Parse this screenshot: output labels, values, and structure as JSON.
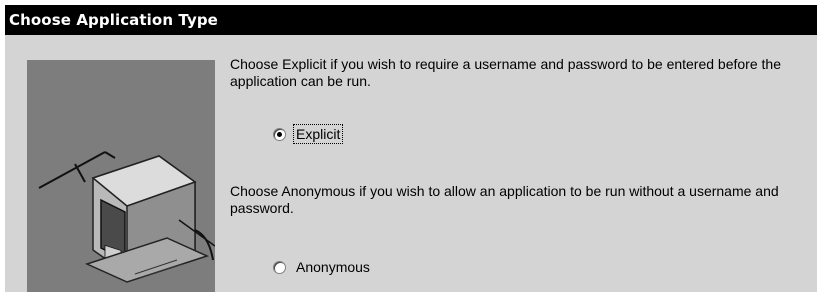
{
  "dialog": {
    "title": "Choose Application Type"
  },
  "content": {
    "explicit_description": "Choose Explicit if you wish to require a username and password to be entered before the application can be run.",
    "anonymous_description": "Choose Anonymous if you wish to allow an application to be run without a username and password."
  },
  "options": {
    "explicit": {
      "label": "Explicit",
      "selected": true
    },
    "anonymous": {
      "label": "Anonymous",
      "selected": false
    }
  },
  "icons": {
    "illustration": "computer-illustration",
    "explicit_radio": "radio-selected",
    "anonymous_radio": "radio-unselected"
  },
  "colors": {
    "title_bar_bg": "#000000",
    "title_bar_text": "#ffffff",
    "dialog_bg": "#d4d4d4",
    "illustration_bg": "#7d7d7d"
  }
}
